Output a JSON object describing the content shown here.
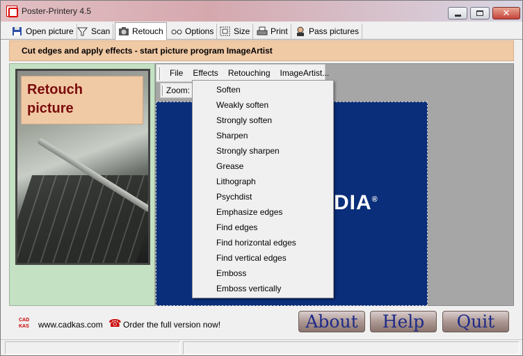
{
  "window": {
    "title": "Poster-Printery 4.5"
  },
  "tabs": [
    {
      "label": "Open picture",
      "icon": "save-icon"
    },
    {
      "label": "Scan",
      "icon": "scanner-icon"
    },
    {
      "label": "Retouch",
      "icon": "camera-icon",
      "active": true
    },
    {
      "label": "Options",
      "icon": "glasses-icon"
    },
    {
      "label": "Size",
      "icon": "resize-icon"
    },
    {
      "label": "Print",
      "icon": "printer-icon"
    },
    {
      "label": "Pass pictures",
      "icon": "person-icon"
    }
  ],
  "banner": {
    "text": "Cut edges and apply effects - start picture program ImageArtist"
  },
  "left_panel": {
    "card_line1": "Retouch",
    "card_line2": "picture"
  },
  "menubar": {
    "file": "File",
    "effects": "Effects",
    "retouching": "Retouching",
    "imageartist": "ImageArtist..."
  },
  "zoom": {
    "label": "Zoom:"
  },
  "canvas": {
    "brand_text": "DIA",
    "brand_mark": "®"
  },
  "effects_menu": [
    "Soften",
    "Weakly soften",
    "Strongly soften",
    "Sharpen",
    "Strongly sharpen",
    "Grease",
    "Lithograph",
    "Psychdist",
    "Emphasize edges",
    "Find edges",
    "Find horizontal edges",
    "Find vertical edges",
    "Emboss",
    "Emboss vertically"
  ],
  "footer": {
    "site": "www.cadkas.com",
    "order": "Order the full version now!",
    "about": "About",
    "help": "Help",
    "quit": "Quit"
  },
  "colors": {
    "banner": "#f0c9a5",
    "left_panel": "#c5e1c4",
    "canvas": "#0a2e7a",
    "accent_text": "#7a0b0b"
  }
}
